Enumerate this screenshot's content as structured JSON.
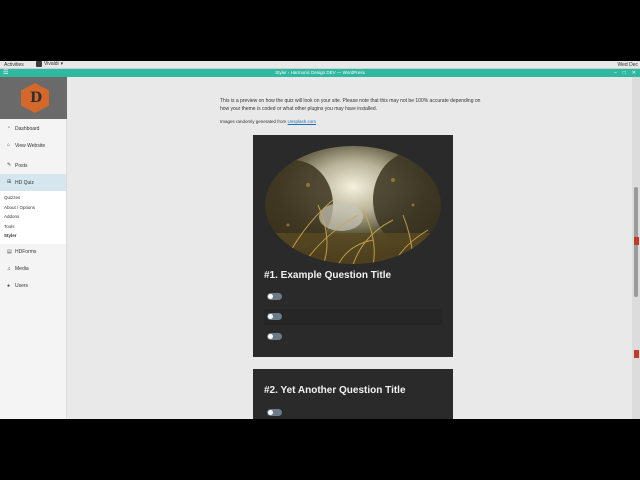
{
  "os": {
    "activities": "Activities",
    "app_name": "Vivaldi",
    "clock": "Wed Dec"
  },
  "browser": {
    "window_title": "Styler ‹ Harmonic Design DEV — WordPress"
  },
  "sidebar": {
    "items": [
      {
        "label": "Dashboard",
        "icon": "dashboard-icon"
      },
      {
        "label": "View Website",
        "icon": "home-icon"
      },
      {
        "label": "Posts",
        "icon": "pin-icon"
      },
      {
        "label": "HD Quiz",
        "icon": "quiz-icon"
      }
    ],
    "sub_items": [
      "Quizzes",
      "About / Options",
      "Addons",
      "Tools",
      "Styler"
    ],
    "items_after": [
      {
        "label": "HDForms",
        "icon": "forms-icon"
      },
      {
        "label": "Media",
        "icon": "media-icon"
      },
      {
        "label": "Users",
        "icon": "user-icon"
      }
    ]
  },
  "content": {
    "intro": "This is a preview on how the quiz will look on your site. Please note that this may not be 100% accurate depending on how your theme is coded or what other plugins you may have installed.",
    "attribution_prefix": "Images randomly generated from ",
    "attribution_link": "Unsplash.com"
  },
  "quiz": {
    "questions": [
      {
        "title": "#1. Example Question Title"
      },
      {
        "title": "#2. Yet Another Question Title"
      }
    ]
  },
  "colors": {
    "accent": "#2fb9a0",
    "card_bg": "#2a2a2a",
    "logo": "#d4682b",
    "active_nav": "#d6e6ef"
  }
}
